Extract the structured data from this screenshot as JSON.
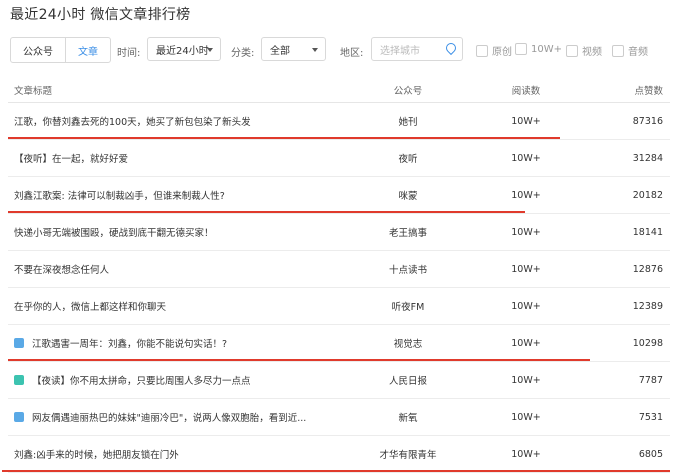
{
  "page_title": "最近24小时 微信文章排行榜",
  "filters": {
    "type_options": [
      "公众号",
      "文章"
    ],
    "time_label": "时间:",
    "time_value": "最近24小时",
    "category_label": "分类:",
    "category_value": "全部",
    "region_label": "地区:",
    "city_placeholder": "选择城市",
    "checkboxes": [
      "原创",
      "10W+",
      "视频",
      "音频"
    ]
  },
  "table": {
    "headers": [
      "文章标题",
      "公众号",
      "阅读数",
      "点赞数"
    ],
    "rows": [
      {
        "title": "江歌，你替刘鑫去死的100天，她买了新包包染了新头发",
        "account": "她刊",
        "reads": "10W+",
        "likes": "87316",
        "icon": "",
        "underline": true
      },
      {
        "title": "【夜听】在一起，就好好爱",
        "account": "夜听",
        "reads": "10W+",
        "likes": "31284",
        "icon": "",
        "underline": false
      },
      {
        "title": "刘鑫江歌案: 法律可以制裁凶手，但谁来制裁人性?",
        "account": "咪蒙",
        "reads": "10W+",
        "likes": "20182",
        "icon": "",
        "underline": true
      },
      {
        "title": "快递小哥无端被围殴，硬战到底干翻无德买家！",
        "account": "老王搞事",
        "reads": "10W+",
        "likes": "18141",
        "icon": "",
        "underline": false
      },
      {
        "title": "不要在深夜想念任何人",
        "account": "十点读书",
        "reads": "10W+",
        "likes": "12876",
        "icon": "",
        "underline": false
      },
      {
        "title": "在乎你的人，微信上都这样和你聊天",
        "account": "听夜FM",
        "reads": "10W+",
        "likes": "12389",
        "icon": "",
        "underline": false
      },
      {
        "title": "江歌遇害一周年：刘鑫，你能不能说句实话！?",
        "account": "视觉志",
        "reads": "10W+",
        "likes": "10298",
        "icon": "video-icon",
        "underline": true
      },
      {
        "title": "【夜读】你不用太拼命，只要比周围人多尽力一点点",
        "account": "人民日报",
        "reads": "10W+",
        "likes": "7787",
        "icon": "audio-icon",
        "underline": false
      },
      {
        "title": "网友偶遇迪丽热巴的妹妹\"迪丽冷巴\"，说两人像双胞胎，看到近...",
        "account": "新氧",
        "reads": "10W+",
        "likes": "7531",
        "icon": "video-icon",
        "underline": false
      },
      {
        "title": "刘鑫:凶手来的时候，她把朋友锁在门外",
        "account": "才华有限青年",
        "reads": "10W+",
        "likes": "6805",
        "icon": "",
        "underline": true
      }
    ]
  },
  "colors": {
    "accent": "#3a8ee6",
    "underline_red": "#e03a2c",
    "video_icon": "#5aa9e6",
    "audio_icon": "#3cc3b0"
  }
}
